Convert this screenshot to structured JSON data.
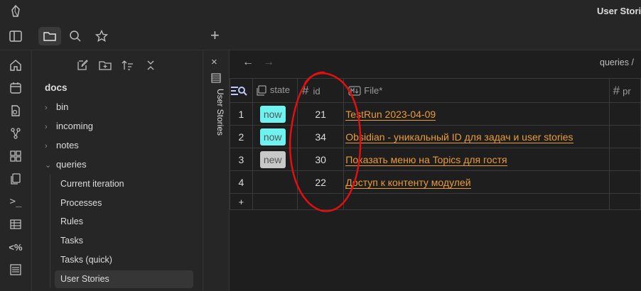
{
  "window": {
    "title": "User Stories"
  },
  "toolbar": {
    "new_tab": "+"
  },
  "sidebar": {
    "root": "docs",
    "folders": [
      {
        "label": "bin",
        "expanded": false
      },
      {
        "label": "incoming",
        "expanded": false
      },
      {
        "label": "notes",
        "expanded": false
      },
      {
        "label": "queries",
        "expanded": true
      }
    ],
    "children": [
      "Current iteration",
      "Processes",
      "Rules",
      "Tasks",
      "Tasks (quick)",
      "User Stories"
    ],
    "selected": "User Stories"
  },
  "tab": {
    "title": "User Stories",
    "close": "×"
  },
  "breadcrumb": {
    "text": "queries /"
  },
  "table": {
    "headers": {
      "state": "state",
      "id": "id",
      "file": "File*",
      "next": "pr"
    },
    "rows": [
      {
        "num": "1",
        "state": "now",
        "id": "21",
        "file": "TestRun 2023-04-09"
      },
      {
        "num": "2",
        "state": "now",
        "id": "34",
        "file": "Obsidian - уникальный ID для задач и user stories"
      },
      {
        "num": "3",
        "state": "new",
        "id": "30",
        "file": "Показать меню на Topics для гостя"
      },
      {
        "num": "4",
        "state": "",
        "id": "22",
        "file": "Доступ к контенту модулей"
      }
    ],
    "add_row": "+"
  },
  "colors": {
    "state_now": "#6ff2f2",
    "state_new": "#c8c8c8",
    "link": "#e89b3c",
    "annotation": "#e01010"
  }
}
